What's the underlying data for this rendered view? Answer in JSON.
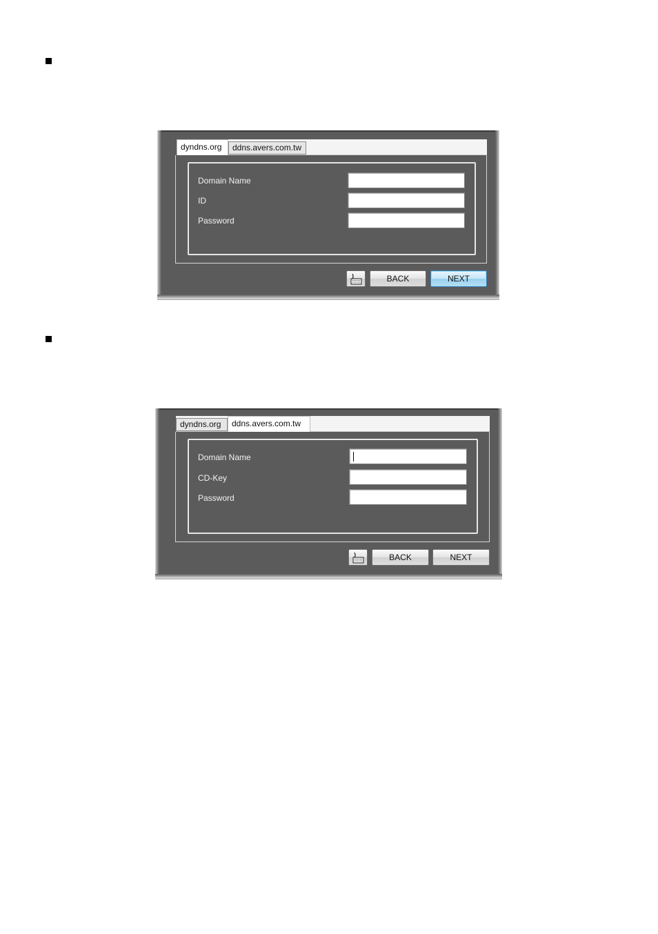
{
  "dialog_dyndns": {
    "tabs": [
      {
        "label": "dyndns.org",
        "active": true
      },
      {
        "label": "ddns.avers.com.tw",
        "active": false
      }
    ],
    "fields": [
      {
        "label": "Domain Name",
        "value": ""
      },
      {
        "label": "ID",
        "value": ""
      },
      {
        "label": "Password",
        "value": ""
      }
    ],
    "buttons": {
      "keyboard_icon": "keyboard-icon",
      "back_label": "BACK",
      "next_label": "NEXT"
    }
  },
  "dialog_avers": {
    "tabs": [
      {
        "label": "dyndns.org",
        "active": false
      },
      {
        "label": "ddns.avers.com.tw",
        "active": true
      }
    ],
    "fields": [
      {
        "label": "Domain Name",
        "value": ""
      },
      {
        "label": "CD-Key",
        "value": ""
      },
      {
        "label": "Password",
        "value": ""
      }
    ],
    "buttons": {
      "keyboard_icon": "keyboard-icon",
      "back_label": "BACK",
      "next_label": "NEXT"
    }
  },
  "colors": {
    "dialog_background": "#5b5b5b",
    "focused_button": "#98d1ef",
    "label_text": "#f2f2f2"
  }
}
